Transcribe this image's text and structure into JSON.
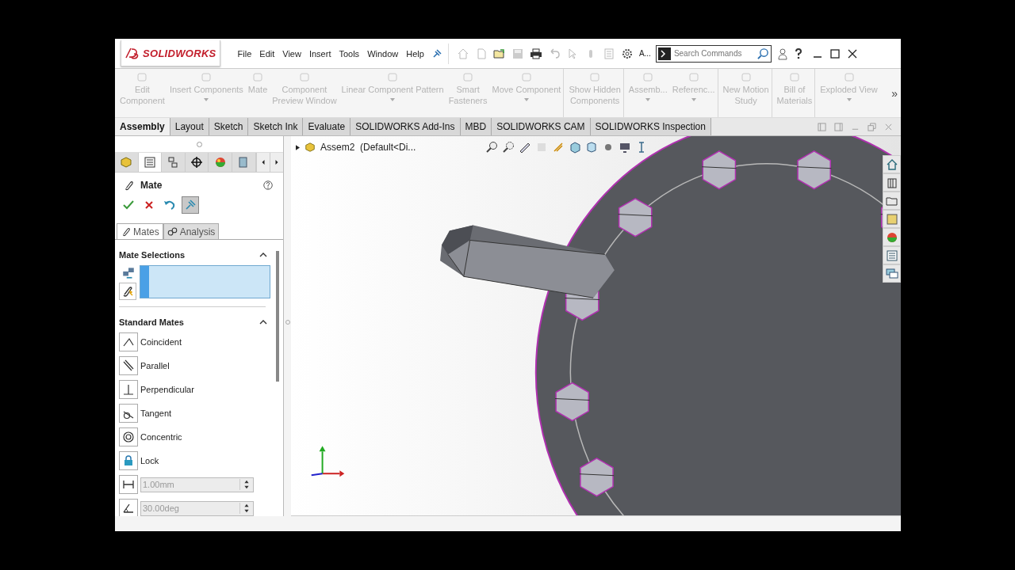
{
  "title_bar": {
    "logo": "SOLIDWORKS",
    "menu": [
      "File",
      "Edit",
      "View",
      "Insert",
      "Tools",
      "Window",
      "Help"
    ],
    "overflow_label": "A...",
    "search": {
      "placeholder": "Search Commands"
    }
  },
  "command_manager": {
    "items": [
      {
        "lines": [
          "Edit",
          "Component"
        ],
        "disabled": true,
        "dropdown": false,
        "group_end": false
      },
      {
        "lines": [
          "Insert Components"
        ],
        "disabled": true,
        "dropdown": true,
        "group_end": false
      },
      {
        "lines": [
          "Mate"
        ],
        "disabled": true,
        "dropdown": false,
        "group_end": false
      },
      {
        "lines": [
          "Component",
          "Preview Window"
        ],
        "disabled": true,
        "dropdown": false,
        "group_end": false
      },
      {
        "lines": [
          "Linear Component Pattern"
        ],
        "disabled": true,
        "dropdown": true,
        "group_end": false
      },
      {
        "lines": [
          "Smart",
          "Fasteners"
        ],
        "disabled": true,
        "dropdown": false,
        "group_end": false
      },
      {
        "lines": [
          "Move Component"
        ],
        "disabled": true,
        "dropdown": true,
        "group_end": true
      },
      {
        "lines": [
          "Show Hidden",
          "Components"
        ],
        "disabled": true,
        "dropdown": false,
        "group_end": true
      },
      {
        "lines": [
          "Assemb..."
        ],
        "disabled": true,
        "dropdown": true,
        "group_end": false
      },
      {
        "lines": [
          "Referenc..."
        ],
        "disabled": true,
        "dropdown": true,
        "group_end": true
      },
      {
        "lines": [
          "New Motion",
          "Study"
        ],
        "disabled": true,
        "dropdown": false,
        "group_end": true
      },
      {
        "lines": [
          "Bill of",
          "Materials"
        ],
        "disabled": true,
        "dropdown": false,
        "group_end": true
      },
      {
        "lines": [
          "Exploded View"
        ],
        "disabled": true,
        "dropdown": true,
        "group_end": false
      }
    ],
    "more": "»"
  },
  "tabs": [
    {
      "label": "Assembly",
      "selected": true
    },
    {
      "label": "Layout",
      "selected": false
    },
    {
      "label": "Sketch",
      "selected": false
    },
    {
      "label": "Sketch Ink",
      "selected": false
    },
    {
      "label": "Evaluate",
      "selected": false
    },
    {
      "label": "SOLIDWORKS Add-Ins",
      "selected": false
    },
    {
      "label": "MBD",
      "selected": false
    },
    {
      "label": "SOLIDWORKS CAM",
      "selected": false
    },
    {
      "label": "SOLIDWORKS Inspection",
      "selected": false
    }
  ],
  "panel_tabs": [
    {
      "kind": "tree",
      "selected": false
    },
    {
      "kind": "properties",
      "selected": true
    },
    {
      "kind": "config",
      "selected": false
    },
    {
      "kind": "target",
      "selected": false
    },
    {
      "kind": "appearance",
      "selected": false
    },
    {
      "kind": "cam",
      "selected": false
    }
  ],
  "property_manager": {
    "title": "Mate",
    "pin_pressed": true,
    "subtabs": [
      {
        "label": "Mates",
        "selected": true
      },
      {
        "label": "Analysis",
        "selected": false
      }
    ],
    "mate_selections": {
      "title": "Mate Selections",
      "expanded": true
    },
    "standard_mates": {
      "title": "Standard Mates",
      "expanded": true,
      "items": [
        {
          "kind": "coincident",
          "label": "Coincident"
        },
        {
          "kind": "parallel",
          "label": "Parallel"
        },
        {
          "kind": "perpendicular",
          "label": "Perpendicular"
        },
        {
          "kind": "tangent",
          "label": "Tangent"
        },
        {
          "kind": "concentric",
          "label": "Concentric"
        },
        {
          "kind": "lock",
          "label": "Lock"
        }
      ],
      "fields": [
        {
          "kind": "distance",
          "value": "1.00mm",
          "disabled": true
        },
        {
          "kind": "angle",
          "value": "30.00deg",
          "disabled": true
        }
      ]
    }
  },
  "graphics": {
    "tree_item": "Assem2  (Default<Di..."
  }
}
